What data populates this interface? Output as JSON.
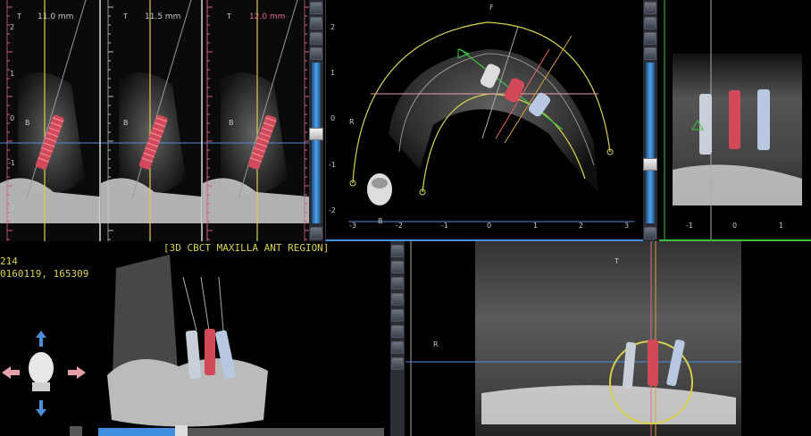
{
  "cross_sections": [
    {
      "t_label": "T",
      "mm": "11.0 mm",
      "b_label": "B",
      "mm_color": "#cfcfcf"
    },
    {
      "t_label": "T",
      "mm": "11.5 mm",
      "b_label": "B",
      "mm_color": "#cfcfcf"
    },
    {
      "t_label": "T",
      "mm": "12.0 mm",
      "b_label": "B",
      "mm_color": "#e06a8a"
    }
  ],
  "axial": {
    "f_label": "F",
    "r_label": "R",
    "b_label": "B",
    "x_ticks": [
      "-3",
      "-2",
      "-1",
      "0",
      "1",
      "2",
      "3"
    ],
    "y_ticks": [
      "2",
      "1",
      "0",
      "-1",
      "-2"
    ]
  },
  "coronal_top": {
    "x_ticks": [
      "-1",
      "0",
      "1"
    ]
  },
  "info_panel": {
    "title": "[3D CBCT MAXILLA ANT REGION]",
    "line1": "214",
    "line2": "0160119, 165309"
  },
  "panoramic": {
    "t_label": "T",
    "r_label": "R"
  },
  "left_ticks": [
    "2",
    "1",
    "0",
    "-1",
    "-2"
  ],
  "colors": {
    "accent_yellow": "#d8d04a",
    "ruler_pink": "#d06080",
    "slider_blue": "#3f8fe0",
    "line_blue": "#4a8fd8"
  }
}
